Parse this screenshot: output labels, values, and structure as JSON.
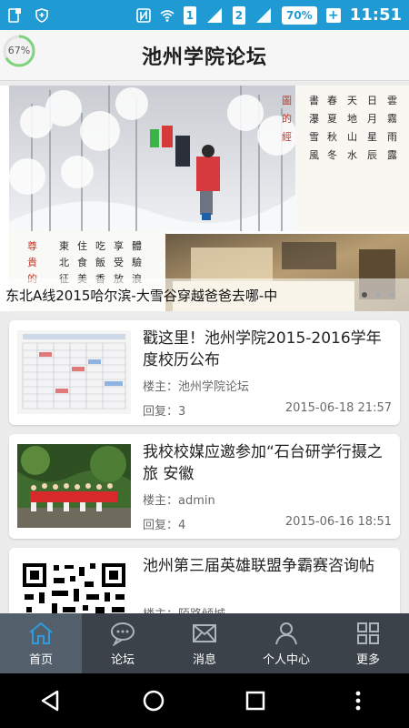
{
  "status_bar": {
    "sim1": "1",
    "sim2": "2",
    "battery": "70%",
    "time": "11:51"
  },
  "header": {
    "title": "池州学院论坛",
    "progress": "67%",
    "progress_value": 0.67
  },
  "banner": {
    "caption": "东北A线2015哈尔滨-大雪谷穿越爸爸去哪-中",
    "dot_count": 3,
    "active_dot": 0
  },
  "posts": [
    {
      "title": "戳这里！池州学院2015-2016学年度校历公布",
      "author": "楼主：池州学院论坛",
      "replies": "回复：3",
      "date": "2015-06-18 21:57"
    },
    {
      "title": "我校校媒应邀参加“石台研学行摄之旅 安徽",
      "author": "楼主：admin",
      "replies": "回复：4",
      "date": "2015-06-16 18:51"
    },
    {
      "title": "池州第三届英雄联盟争霸赛咨询帖",
      "author": "楼主：陌路倾城",
      "replies": "",
      "date": ""
    }
  ],
  "bottom_nav": [
    {
      "label": "首页",
      "icon": "home-icon",
      "active": true
    },
    {
      "label": "论坛",
      "icon": "chat-bubble-icon",
      "active": false
    },
    {
      "label": "消息",
      "icon": "mail-icon",
      "active": false
    },
    {
      "label": "个人中心",
      "icon": "person-icon",
      "active": false
    },
    {
      "label": "更多",
      "icon": "grid-icon",
      "active": false
    }
  ],
  "colors": {
    "status_bar": "#1f9ad2",
    "bottom_nav": "#3c424a",
    "bottom_nav_active": "#53606b",
    "progress_ring": "#7ed37e"
  }
}
